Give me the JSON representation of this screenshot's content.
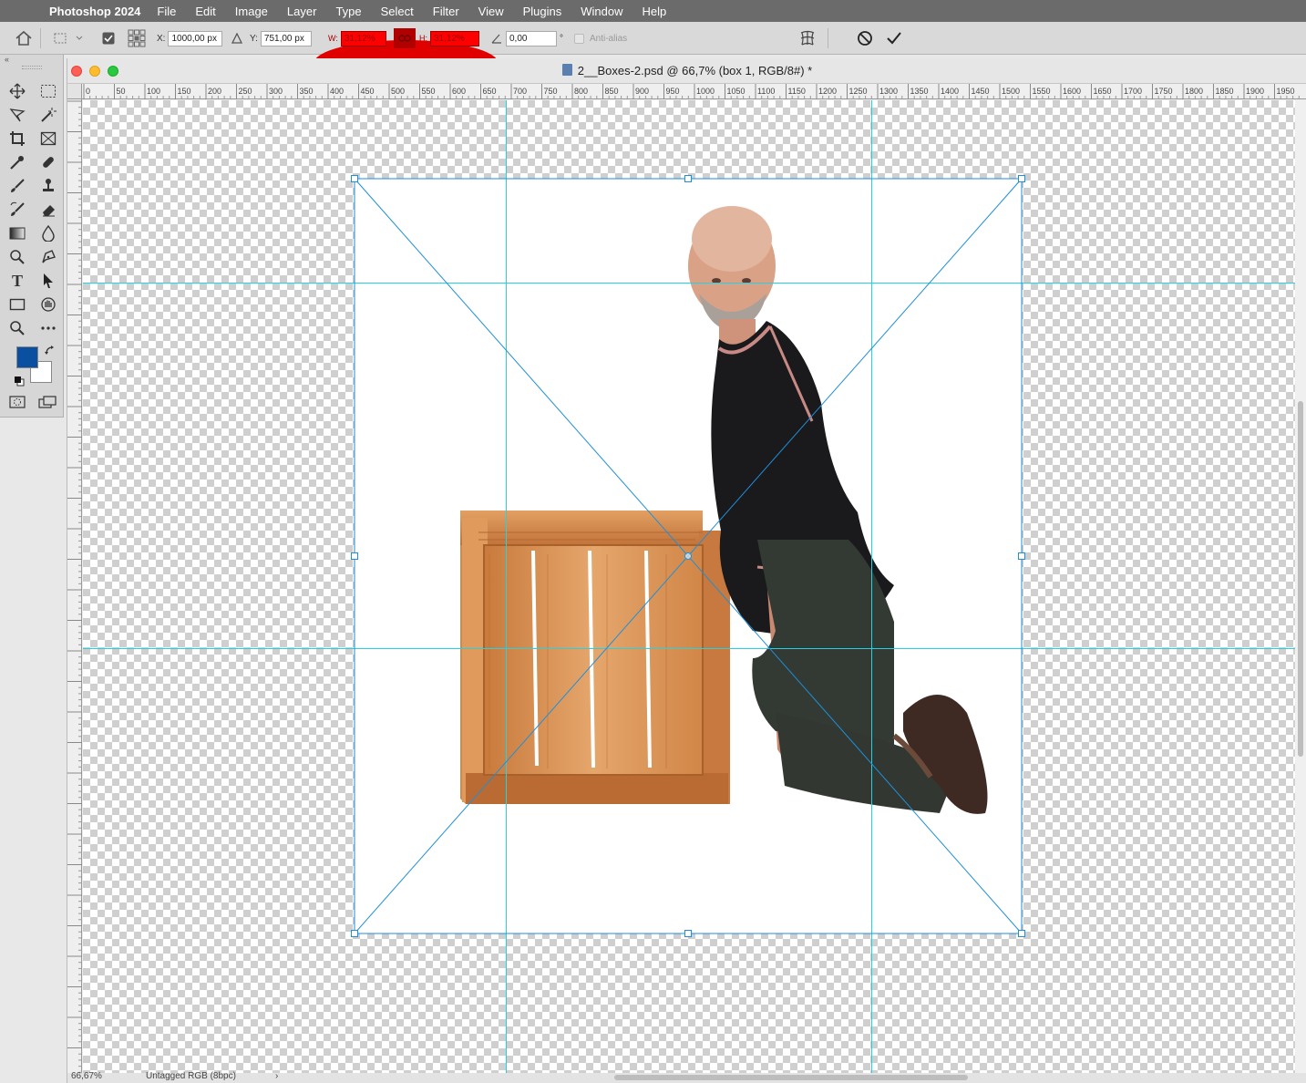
{
  "menubar": {
    "app_name": "Photoshop 2024",
    "items": [
      "File",
      "Edit",
      "Image",
      "Layer",
      "Type",
      "Select",
      "Filter",
      "View",
      "Plugins",
      "Window",
      "Help"
    ]
  },
  "options": {
    "x_label": "X:",
    "x_value": "1000,00 px",
    "y_label": "Y:",
    "y_value": "751,00 px",
    "w_label": "W:",
    "w_value": "31,12%",
    "h_label": "H:",
    "h_value": "31,12%",
    "angle_value": "0,00",
    "degree_symbol": "°",
    "antialias_label": "Anti-alias"
  },
  "document": {
    "title": "2__Boxes-2.psd @ 66,7% (box 1, RGB/8#) *",
    "zoom": "66,67%",
    "profile": "Untagged RGB (8bpc)"
  },
  "ruler": {
    "h_ticks": [
      "0",
      "50",
      "100",
      "150",
      "200",
      "250",
      "300",
      "350",
      "400",
      "450",
      "500",
      "550",
      "600",
      "650",
      "700",
      "750",
      "800",
      "850",
      "900",
      "950",
      "1000",
      "1050",
      "1100",
      "1150",
      "1200",
      "1250",
      "1300",
      "1350",
      "1400",
      "1450",
      "1500",
      "1550",
      "1600",
      "1650",
      "1700",
      "1750",
      "1800",
      "1850",
      "1900",
      "1950"
    ]
  },
  "colors": {
    "foreground": "#0a4fa0",
    "background": "#ffffff",
    "guide": "#22d3e6",
    "transform": "#1f8fd9",
    "highlight": "#e00000"
  },
  "icons": {
    "home": "home-icon",
    "commit": "check-icon",
    "cancel": "cancel-icon",
    "warp": "warp-icon",
    "link": "link-icon"
  }
}
